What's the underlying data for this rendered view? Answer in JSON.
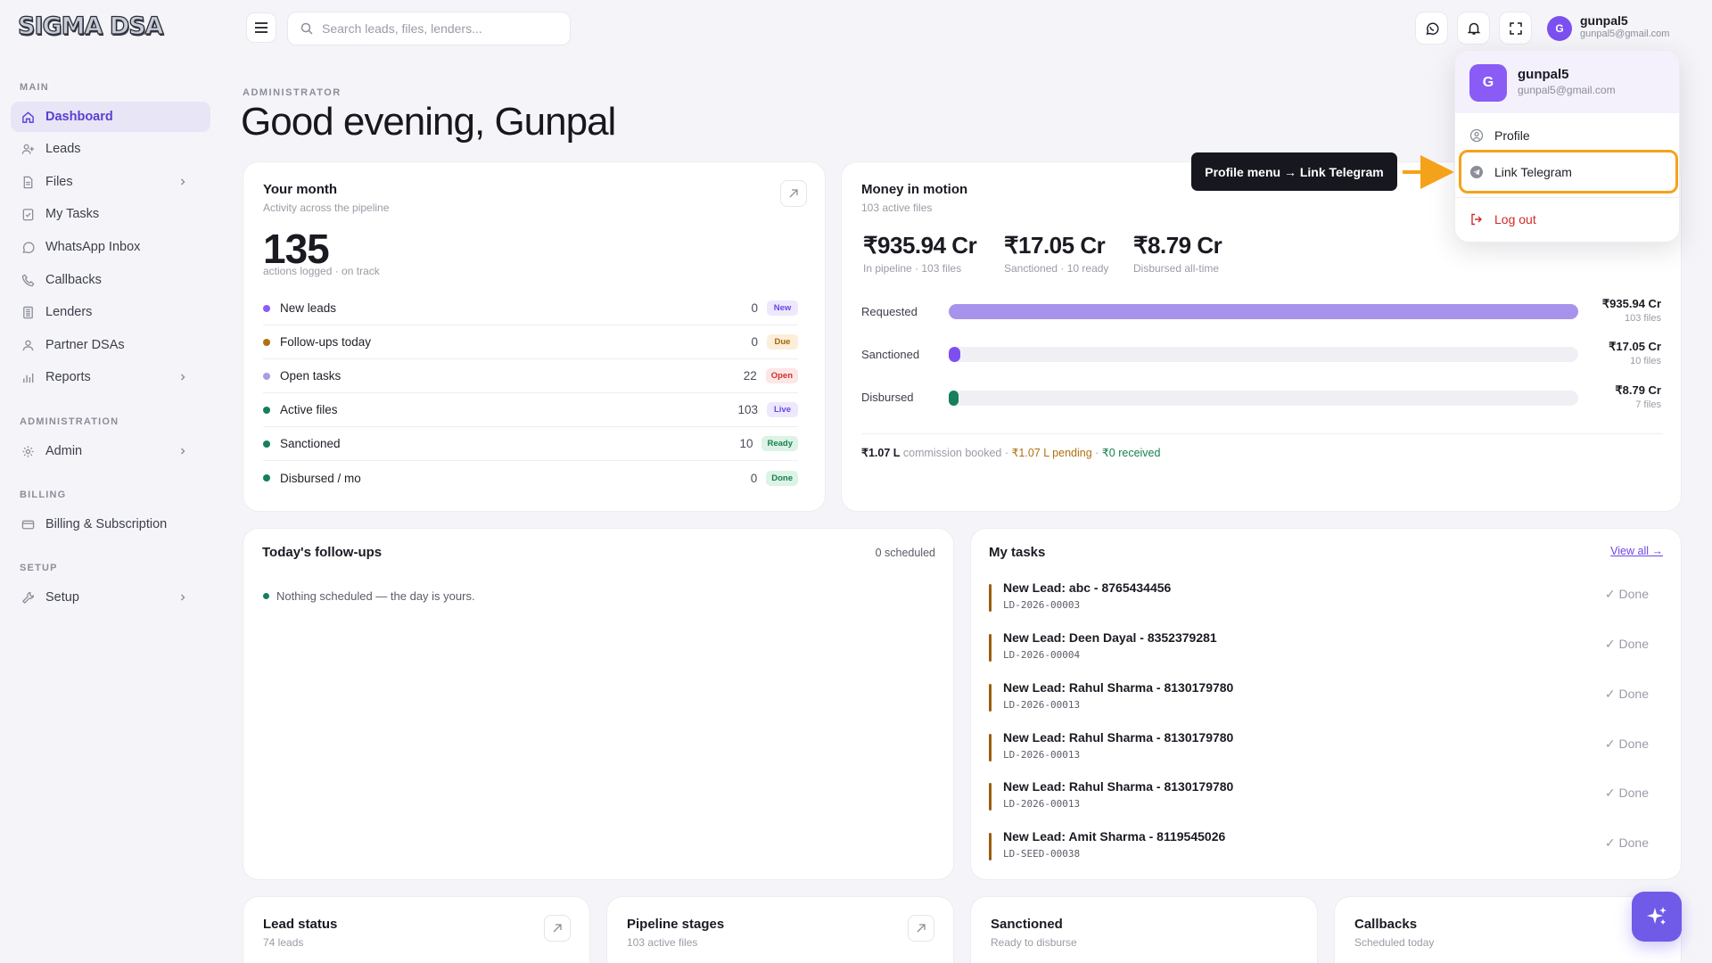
{
  "brand": {
    "name": "SIGMA DSA"
  },
  "sidebar": {
    "sections": [
      "MAIN",
      "ADMINISTRATION",
      "BILLING",
      "SETUP"
    ],
    "items": [
      {
        "label": "Dashboard",
        "icon": "home-icon"
      },
      {
        "label": "Leads",
        "icon": "user-plus-icon"
      },
      {
        "label": "Files",
        "icon": "file-icon"
      },
      {
        "label": "My Tasks",
        "icon": "checklist-icon"
      },
      {
        "label": "WhatsApp Inbox",
        "icon": "whatsapp-icon"
      },
      {
        "label": "Callbacks",
        "icon": "phone-icon"
      },
      {
        "label": "Lenders",
        "icon": "building-icon"
      },
      {
        "label": "Partner DSAs",
        "icon": "users-icon"
      },
      {
        "label": "Reports",
        "icon": "bar-chart-icon"
      },
      {
        "label": "Admin",
        "icon": "gear-icon"
      },
      {
        "label": "Billing & Subscription",
        "icon": "card-icon"
      },
      {
        "label": "Setup",
        "icon": "wrench-icon"
      }
    ]
  },
  "topbar": {
    "search_placeholder": "Search leads, files, lenders...",
    "user": {
      "initial": "G",
      "name": "gunpal5",
      "email": "gunpal5@gmail.com"
    }
  },
  "header": {
    "role": "ADMINISTRATOR",
    "greeting": "Good evening, Gunpal"
  },
  "month_card": {
    "title": "Your month",
    "subtitle": "Activity across the pipeline",
    "count": "135",
    "count_caption": "actions logged · on track",
    "rows": [
      {
        "label": "New leads",
        "value": "0",
        "badge": "New",
        "dot": "#8b5cf6",
        "badge_bg": "#ede8fd",
        "badge_fg": "#6d46e0"
      },
      {
        "label": "Follow-ups today",
        "value": "0",
        "badge": "Due",
        "dot": "#b07010",
        "badge_bg": "#fbefd9",
        "badge_fg": "#a46508"
      },
      {
        "label": "Open tasks",
        "value": "22",
        "badge": "Open",
        "dot": "#a79ce6",
        "badge_bg": "#fde6e6",
        "badge_fg": "#cf3030"
      },
      {
        "label": "Active files",
        "value": "103",
        "badge": "Live",
        "dot": "#15805a",
        "badge_bg": "#ede8fd",
        "badge_fg": "#6d46e0"
      },
      {
        "label": "Sanctioned",
        "value": "10",
        "badge": "Ready",
        "dot": "#15805a",
        "badge_bg": "#dcf3e6",
        "badge_fg": "#17804f"
      },
      {
        "label": "Disbursed / mo",
        "value": "0",
        "badge": "Done",
        "dot": "#15805a",
        "badge_bg": "#dcf3e6",
        "badge_fg": "#17804f"
      }
    ]
  },
  "money_card": {
    "title": "Money in motion",
    "subtitle": "103 active files",
    "stats": [
      {
        "value": "₹935.94 Cr",
        "caption": "In pipeline · 103 files"
      },
      {
        "value": "₹17.05 Cr",
        "caption": "Sanctioned · 10 ready"
      },
      {
        "value": "₹8.79 Cr",
        "caption": "Disbursed all-time"
      }
    ],
    "bars": [
      {
        "label": "Requested",
        "amount": "₹935.94 Cr",
        "count": "103 files",
        "fill_pct": 100,
        "color": "#a893ec"
      },
      {
        "label": "Sanctioned",
        "amount": "₹17.05 Cr",
        "count": "10 files",
        "fill_pct": 1.8,
        "color": "#7c4ff0"
      },
      {
        "label": "Disbursed",
        "amount": "₹8.79 Cr",
        "count": "7 files",
        "fill_pct": 0.9,
        "color": "#15805a"
      }
    ],
    "commission": {
      "booked": "₹1.07 L",
      "booked_label": "commission booked ·",
      "pending": "₹1.07 L pending",
      "sep": "·",
      "received": "₹0 received"
    }
  },
  "followups": {
    "title": "Today's follow-ups",
    "count": "0 scheduled",
    "empty": "Nothing scheduled — the day is yours."
  },
  "tasks": {
    "title": "My tasks",
    "view_all": "View all →",
    "done_label": "Done",
    "items": [
      {
        "name": "New Lead: abc - 8765434456",
        "id": "LD-2026-00003"
      },
      {
        "name": "New Lead: Deen Dayal - 8352379281",
        "id": "LD-2026-00004"
      },
      {
        "name": "New Lead: Rahul Sharma - 8130179780",
        "id": "LD-2026-00013"
      },
      {
        "name": "New Lead: Rahul Sharma - 8130179780",
        "id": "LD-2026-00013"
      },
      {
        "name": "New Lead: Rahul Sharma - 8130179780",
        "id": "LD-2026-00013"
      },
      {
        "name": "New Lead: Amit Sharma - 8119545026",
        "id": "LD-SEED-00038"
      }
    ]
  },
  "bottom_cards": [
    {
      "title": "Lead status",
      "subtitle": "74 leads"
    },
    {
      "title": "Pipeline stages",
      "subtitle": "103 active files"
    },
    {
      "title": "Sanctioned",
      "subtitle": "Ready to disburse"
    },
    {
      "title": "Callbacks",
      "subtitle": "Scheduled today"
    }
  ],
  "profile_menu": {
    "initial": "G",
    "name": "gunpal5",
    "email": "gunpal5@gmail.com",
    "items": [
      "Profile",
      "Link Telegram",
      "Log out"
    ]
  },
  "callout": {
    "text": "Profile menu → Link Telegram"
  }
}
